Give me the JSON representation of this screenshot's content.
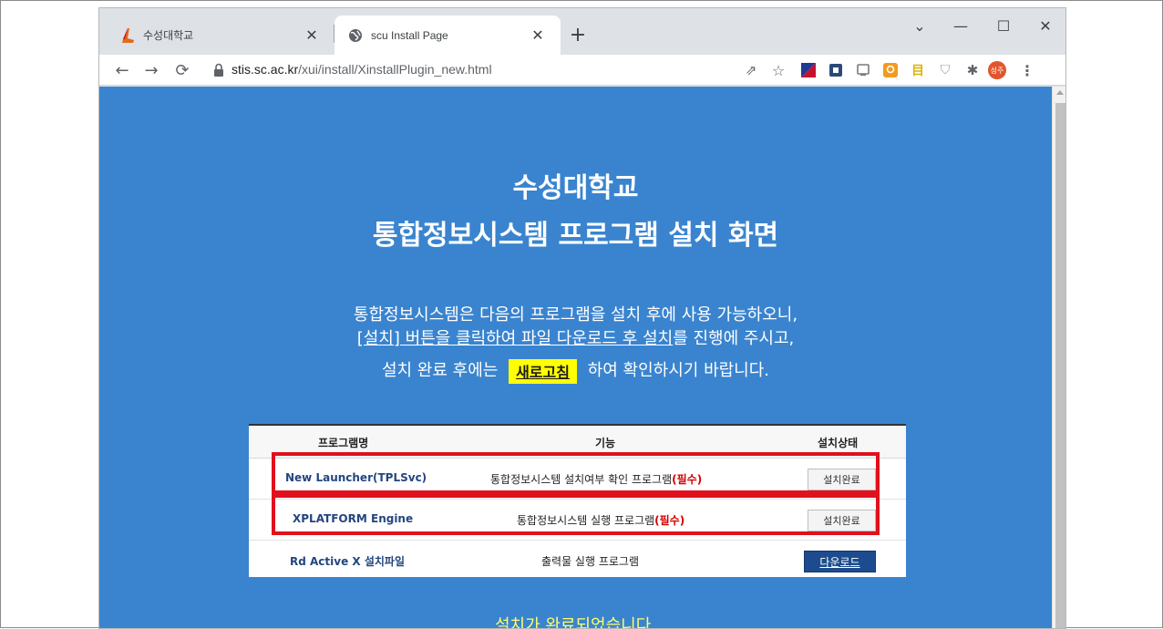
{
  "browser": {
    "tabs": [
      {
        "title": "수성대학교",
        "active": false,
        "favicon": "scu-logo-icon"
      },
      {
        "title": "scu Install Page",
        "active": true,
        "favicon": "globe-icon"
      }
    ],
    "address": {
      "host": "stis.sc.ac.kr",
      "path": "/xui/install/XinstallPlugin_new.html"
    },
    "profile_label": "성주"
  },
  "page": {
    "heading_line1": "수성대학교",
    "heading_line2": "통합정보시스템 프로그램 설치 화면",
    "intro_line1": "통합정보시스템은 다음의 프로그램을 설치 후에 사용 가능하오니,",
    "intro_line2_underlined": "[설치] 버튼을 클릭하여 파일 다운로드 후 설치",
    "intro_line2_rest": "를 진행에 주시고,",
    "intro_line3_before": "설치 완료 후에는",
    "refresh_label": "새로고침",
    "intro_line3_after": "하여 확인하시기 바랍니다.",
    "table": {
      "headers": {
        "name": "프로그램명",
        "function": "기능",
        "status": "설치상태"
      },
      "rows": [
        {
          "name": "New Launcher(TPLSvc)",
          "function": "통합정보시스템 설치여부 확인 프로그램",
          "required": "(필수)",
          "action": "설치완료"
        },
        {
          "name": "XPLATFORM Engine",
          "function": "통합정보시스템 실행 프로그램",
          "required": "(필수)",
          "action": "설치완료"
        },
        {
          "name": "Rd Active X 설치파일",
          "function": "출력물 실행 프로그램",
          "required": "",
          "action": "다운로드"
        }
      ]
    },
    "complete_message": "설치가 완료되었습니다."
  },
  "colors": {
    "page_bg": "#3a84cf",
    "highlight_box": "#e0101c",
    "refresh_bg": "#ffff00",
    "download_bg": "#1c4c8e",
    "complete_text": "#ffff66"
  }
}
